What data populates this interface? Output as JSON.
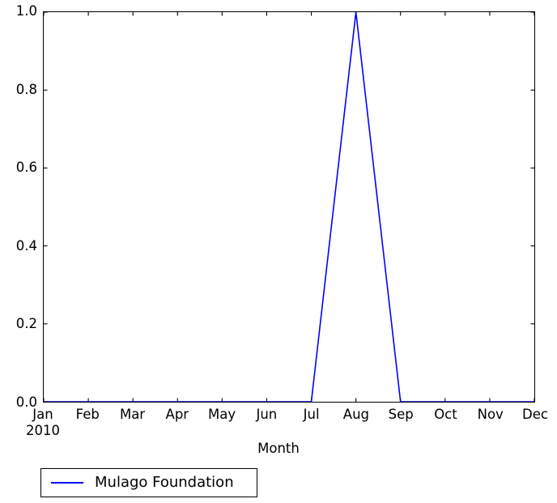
{
  "chart_data": {
    "type": "line",
    "title": "",
    "xlabel": "Month",
    "ylabel": "",
    "categories": [
      "Jan",
      "Feb",
      "Mar",
      "Apr",
      "May",
      "Jun",
      "Jul",
      "Aug",
      "Sep",
      "Oct",
      "Nov",
      "Dec"
    ],
    "x_sublabel": "2010",
    "x_sublabel_at": "Jan",
    "series": [
      {
        "name": "Mulago Foundation",
        "color": "#0000ff",
        "values": [
          0.0,
          0.0,
          0.0,
          0.0,
          0.0,
          0.0,
          0.0,
          1.0,
          0.0,
          0.0,
          0.0,
          0.0
        ]
      }
    ],
    "ylim": [
      0.0,
      1.0
    ],
    "yticks": [
      0.0,
      0.2,
      0.4,
      0.6,
      0.8,
      1.0
    ],
    "ytick_labels": [
      "0.0",
      "0.2",
      "0.4",
      "0.6",
      "0.8",
      "1.0"
    ],
    "xtick_labels": [
      "Jan",
      "Feb",
      "Mar",
      "Apr",
      "May",
      "Jun",
      "Jul",
      "Aug",
      "Sep",
      "Oct",
      "Nov",
      "Dec"
    ],
    "grid": false,
    "legend_position": "below-axes",
    "legend_entries": [
      "Mulago Foundation"
    ]
  },
  "axis": {
    "x_title": "Month",
    "year_label": "2010"
  },
  "legend": {
    "items": [
      {
        "label": "Mulago Foundation",
        "color": "#0000ff"
      }
    ]
  }
}
